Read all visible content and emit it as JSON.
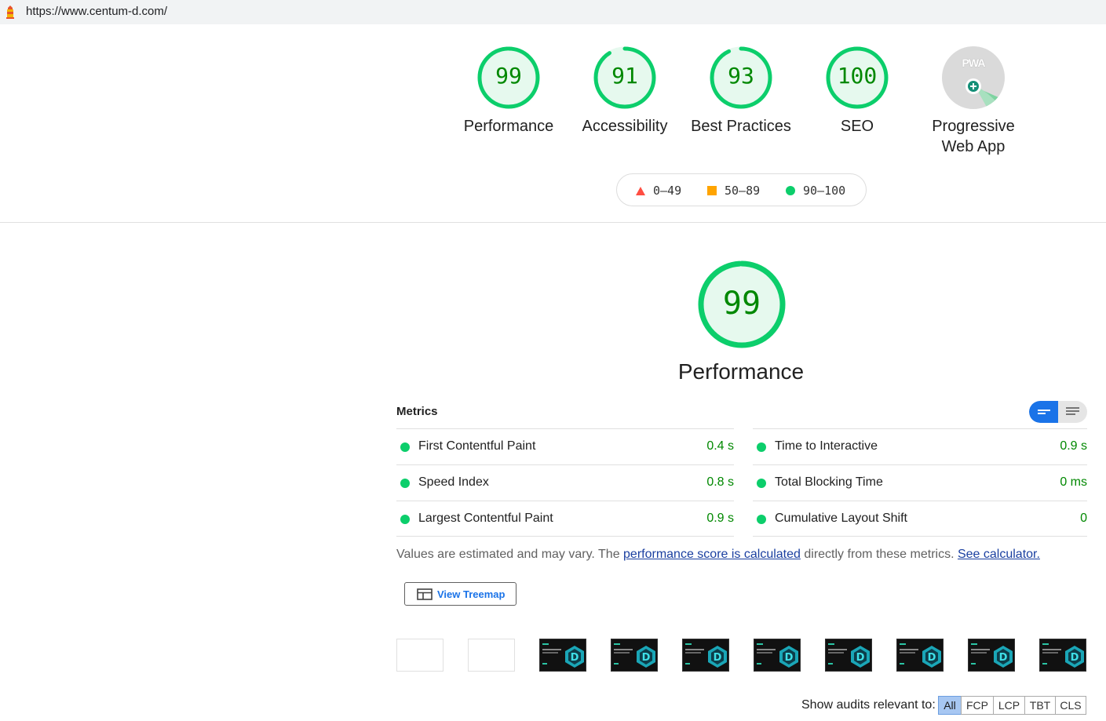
{
  "address_bar": {
    "url": "https://www.centum-d.com/"
  },
  "categories": [
    {
      "label": "Performance",
      "score": "99",
      "score_value": 99
    },
    {
      "label": "Accessibility",
      "score": "91",
      "score_value": 91
    },
    {
      "label": "Best Practices",
      "score": "93",
      "score_value": 93
    },
    {
      "label": "SEO",
      "score": "100",
      "score_value": 100
    }
  ],
  "pwa": {
    "label_line1": "Progressive",
    "label_line2": "Web App",
    "badge_text": "PWA"
  },
  "legend": [
    {
      "range": "0–49",
      "color": "#ff4e42"
    },
    {
      "range": "50–89",
      "color": "#ffa400"
    },
    {
      "range": "90–100",
      "color": "#0cce6b"
    }
  ],
  "performance": {
    "score": "99",
    "score_value": 99,
    "title": "Performance"
  },
  "metrics": {
    "heading": "Metrics",
    "left": [
      {
        "name": "First Contentful Paint",
        "value": "0.4 s"
      },
      {
        "name": "Speed Index",
        "value": "0.8 s"
      },
      {
        "name": "Largest Contentful Paint",
        "value": "0.9 s"
      }
    ],
    "right": [
      {
        "name": "Time to Interactive",
        "value": "0.9 s"
      },
      {
        "name": "Total Blocking Time",
        "value": "0 ms"
      },
      {
        "name": "Cumulative Layout Shift",
        "value": "0"
      }
    ]
  },
  "note": {
    "text1": "Values are estimated and may vary. The ",
    "link1": "performance score is calculated",
    "text2": " directly from these metrics. ",
    "link2": "See calculator."
  },
  "treemap_button": {
    "label": "View Treemap"
  },
  "filmstrip": {
    "blank_count": 2,
    "frame_count": 8
  },
  "audit_filter": {
    "label": "Show audits relevant to:",
    "chips": [
      "All",
      "FCP",
      "LCP",
      "TBT",
      "CLS"
    ],
    "active": "All"
  },
  "colors": {
    "pass": "#0cce6b",
    "pass_text": "#008800",
    "pass_fill": "#e6f9ee",
    "accent": "#1a73e8"
  }
}
